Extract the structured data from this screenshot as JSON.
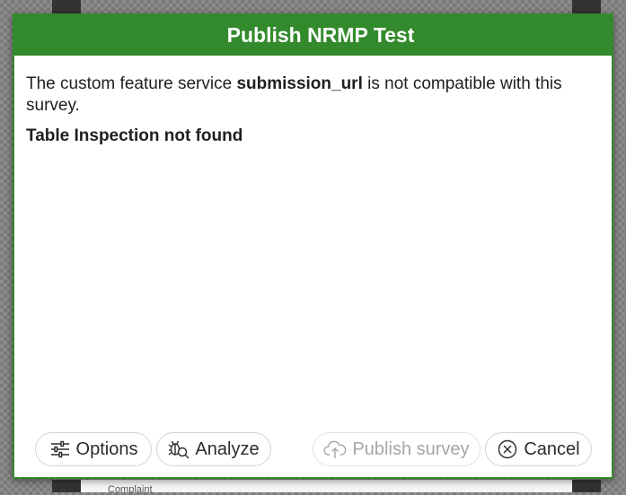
{
  "background": {
    "label": "Complaint"
  },
  "dialog": {
    "title": "Publish NRMP Test",
    "message_prefix": "The custom feature service ",
    "message_field": "submission_url",
    "message_suffix": " is not compatible with this survey.",
    "error": "Table Inspection not found"
  },
  "buttons": {
    "options": {
      "label": "Options",
      "icon": "sliders-icon"
    },
    "analyze": {
      "label": "Analyze",
      "icon": "bug-search-icon"
    },
    "publish": {
      "label": "Publish survey",
      "icon": "cloud-upload-icon",
      "enabled": false
    },
    "cancel": {
      "label": "Cancel",
      "icon": "circle-x-icon"
    }
  },
  "colors": {
    "accent": "#338a2c",
    "title_text": "#ffffff",
    "disabled_text": "#a6a6a6"
  }
}
